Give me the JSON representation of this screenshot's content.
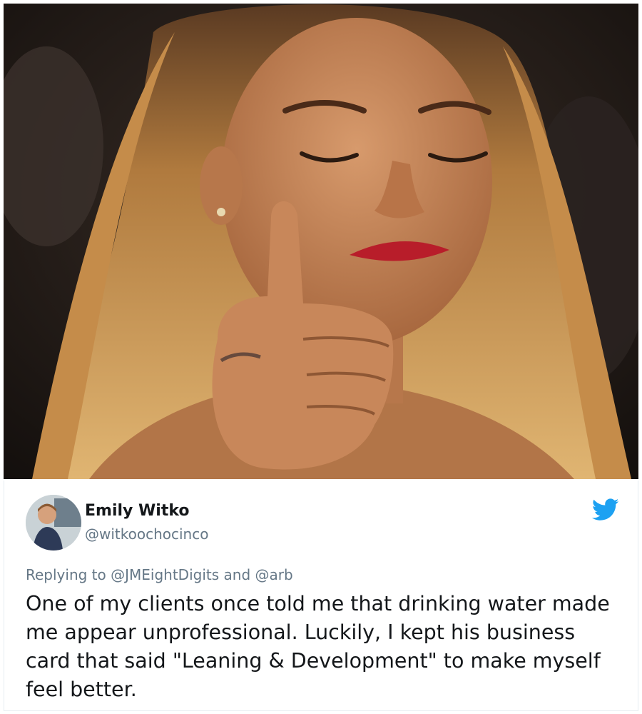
{
  "photo": {
    "icon": "person-thumbs-up-photo"
  },
  "tweet": {
    "display_name": "Emily Witko",
    "handle": "@witkoochocinco",
    "reply_prefix": "Replying to",
    "reply_mentions": [
      "@JMEightDigits",
      "@arb"
    ],
    "reply_joiner": "and",
    "text": "One of my clients once told me that drinking water made me appear unprofessional. Luckily, I kept his business card that said \"Leaning & Development\" to make myself feel better.",
    "brand_color": "#1da1f2",
    "icons": {
      "avatar": "avatar-photo",
      "platform": "twitter-bird-icon"
    }
  }
}
